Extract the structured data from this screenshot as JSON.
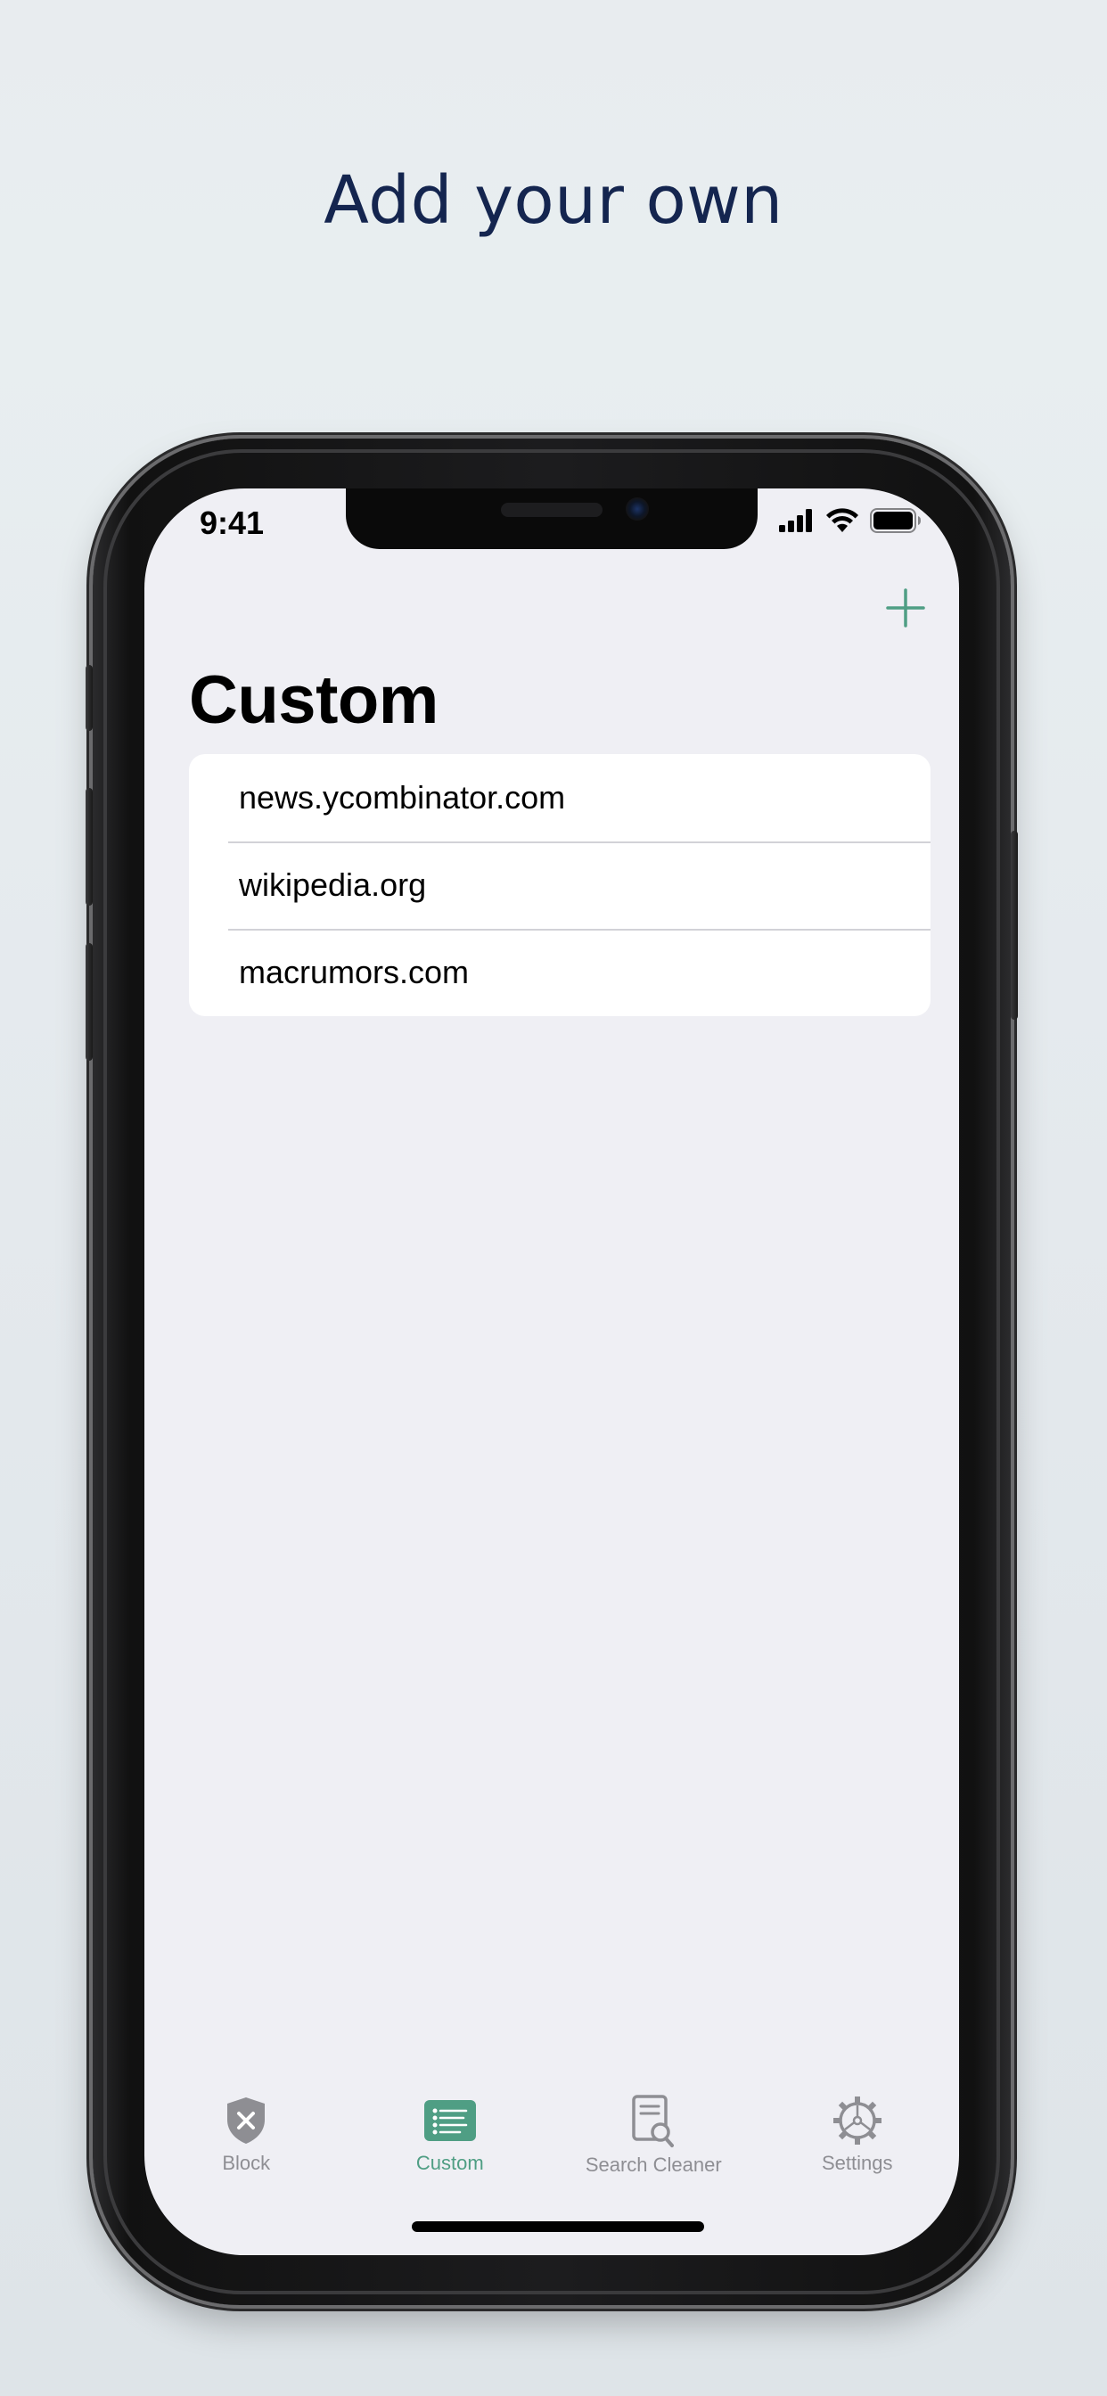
{
  "headline": "Add your own",
  "colors": {
    "accent": "#4f9e84",
    "headline": "#14254f",
    "inactive_tab": "#8e8e93"
  },
  "status_bar": {
    "time": "9:41",
    "icons": [
      "cellular-signal-icon",
      "wifi-icon",
      "battery-icon"
    ]
  },
  "nav": {
    "add_icon": "plus-icon",
    "title": "Custom"
  },
  "custom_list": {
    "items": [
      {
        "label": "news.ycombinator.com"
      },
      {
        "label": "wikipedia.org"
      },
      {
        "label": "macrumors.com"
      }
    ]
  },
  "tabbar": {
    "selected": "Custom",
    "tabs": [
      {
        "label": "Block",
        "icon": "shield-x-icon"
      },
      {
        "label": "Custom",
        "icon": "list-icon"
      },
      {
        "label": "Search Cleaner",
        "icon": "document-search-icon"
      },
      {
        "label": "Settings",
        "icon": "gear-icon"
      }
    ]
  }
}
